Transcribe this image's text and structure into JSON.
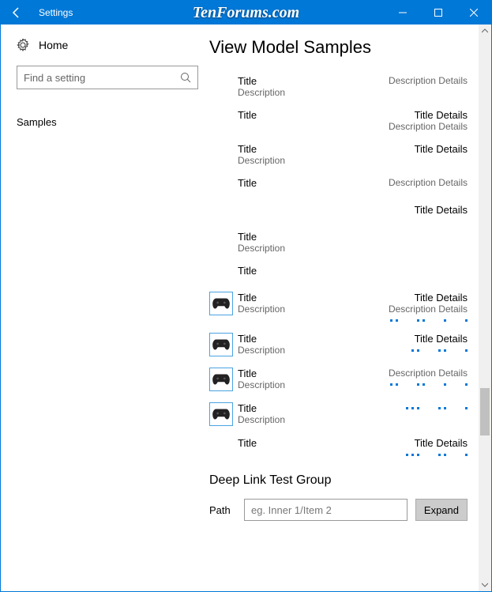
{
  "window": {
    "title": "Settings",
    "watermark": "TenForums.com"
  },
  "sidebar": {
    "home": "Home",
    "search_placeholder": "Find a setting",
    "nav": [
      {
        "label": "Samples"
      }
    ]
  },
  "page": {
    "title": "View Model Samples"
  },
  "samples": [
    {
      "icon": false,
      "title": "Title",
      "desc": "Description",
      "rtitle": "",
      "rdesc": "Description Details",
      "dots": []
    },
    {
      "icon": false,
      "title": "Title",
      "desc": "",
      "rtitle": "Title Details",
      "rdesc": "Description Details",
      "dots": []
    },
    {
      "icon": false,
      "title": "Title",
      "desc": "Description",
      "rtitle": "Title Details",
      "rdesc": "",
      "dots": []
    },
    {
      "icon": false,
      "title": "Title",
      "desc": "",
      "rtitle": "",
      "rdesc": "Description Details",
      "dots": []
    },
    {
      "icon": false,
      "title": "",
      "desc": "",
      "rtitle": "Title Details",
      "rdesc": "",
      "dots": []
    },
    {
      "icon": false,
      "title": "Title",
      "desc": "Description",
      "rtitle": "",
      "rdesc": "",
      "dots": []
    },
    {
      "icon": false,
      "title": "Title",
      "desc": "",
      "rtitle": "",
      "rdesc": "",
      "dots": []
    },
    {
      "icon": true,
      "title": "Title",
      "desc": "Description",
      "rtitle": "Title Details",
      "rdesc": "Description Details",
      "dots": [
        2,
        2,
        1,
        1
      ]
    },
    {
      "icon": true,
      "title": "Title",
      "desc": "Description",
      "rtitle": "Title Details",
      "rdesc": "",
      "dots": [
        2,
        2,
        1
      ]
    },
    {
      "icon": true,
      "title": "Title",
      "desc": "Description",
      "rtitle": "",
      "rdesc": "Description Details",
      "dots": [
        2,
        2,
        1,
        1
      ]
    },
    {
      "icon": true,
      "title": "Title",
      "desc": "Description",
      "rtitle": "",
      "rdesc": "",
      "dots": [
        3,
        2,
        1
      ]
    },
    {
      "icon": false,
      "title": "Title",
      "desc": "",
      "rtitle": "Title Details",
      "rdesc": "",
      "dots": [
        3,
        2,
        1
      ]
    }
  ],
  "deep_link": {
    "group_title": "Deep Link Test Group",
    "path_label": "Path",
    "path_placeholder": "eg. Inner 1/Item 2",
    "expand_label": "Expand"
  }
}
